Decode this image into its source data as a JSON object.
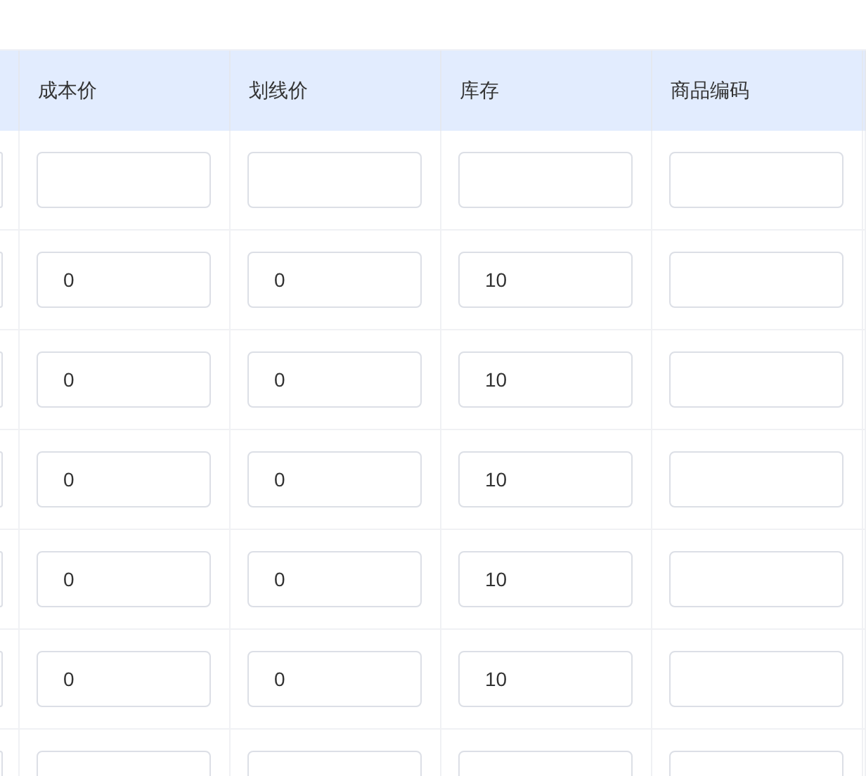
{
  "table": {
    "columns": [
      "成本价",
      "划线价",
      "库存",
      "商品编码"
    ],
    "rows": [
      {
        "cells": [
          {},
          {},
          {},
          {}
        ]
      },
      {
        "cells": [
          {
            "value": "0"
          },
          {
            "value": "0"
          },
          {
            "value": "10"
          },
          {}
        ]
      },
      {
        "cells": [
          {
            "value": "0"
          },
          {
            "value": "0"
          },
          {
            "value": "10"
          },
          {}
        ]
      },
      {
        "cells": [
          {
            "value": "0"
          },
          {
            "value": "0"
          },
          {
            "value": "10"
          },
          {}
        ]
      },
      {
        "cells": [
          {
            "value": "0"
          },
          {
            "value": "0"
          },
          {
            "value": "10"
          },
          {}
        ]
      },
      {
        "cells": [
          {
            "value": "0"
          },
          {
            "value": "0"
          },
          {
            "value": "10"
          },
          {}
        ]
      },
      {
        "cells": [
          {},
          {},
          {},
          {}
        ]
      }
    ]
  }
}
